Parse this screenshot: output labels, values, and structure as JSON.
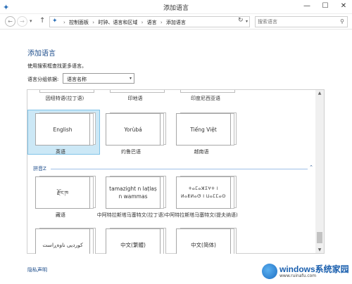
{
  "window": {
    "title": "添加语言",
    "min": "—",
    "max": "☐",
    "close": "✕"
  },
  "nav": {
    "breadcrumbs": [
      "控制面板",
      "时钟、语言和区域",
      "语言",
      "添加语言"
    ],
    "search_placeholder": "搜索语言"
  },
  "page": {
    "title": "添加语言",
    "help": "使用搜索框查找更多语言。",
    "group_by_label": "语言分组依据:",
    "group_by_value": "语言名称"
  },
  "list": {
    "partial_row": [
      "因纽特语(拉丁语)",
      "印地语",
      "印度尼西亚语"
    ],
    "row1": [
      {
        "sample": "English",
        "name": "英语"
      },
      {
        "sample": "Yorùbá",
        "name": "约鲁巴语"
      },
      {
        "sample": "Tiếng Việt",
        "name": "越南语"
      }
    ],
    "group_label": "拼音Z",
    "row2": [
      {
        "sample": "རྫོང་ཁ",
        "name": "藏语"
      },
      {
        "sample": "tamazight n laṭlaṣ n wammas",
        "name": "中阿特拉斯塔马塞特文(拉丁语)"
      },
      {
        "sample": "ⵜⴰⵎⴰⵣⵉⵖⵜ ⵏ ⵍⴰⵟⵍⴰⵚ ⵏ ⵡⴰⵎⵎⴰⵙ",
        "name": "中阿特拉斯塔马塞特文(提夫纳语)"
      }
    ],
    "row3": [
      {
        "sample": "کوردیی ناوەڕاست"
      },
      {
        "sample": "中文(繁體)"
      },
      {
        "sample": "中文(简体)"
      }
    ]
  },
  "footer": {
    "privacy": "隐私声明"
  },
  "watermark": {
    "brand": "windows系统家园",
    "url": "www.ruinafu.com"
  },
  "colors": {
    "accent": "#1e4e8c",
    "selection": "#cce8f6"
  }
}
